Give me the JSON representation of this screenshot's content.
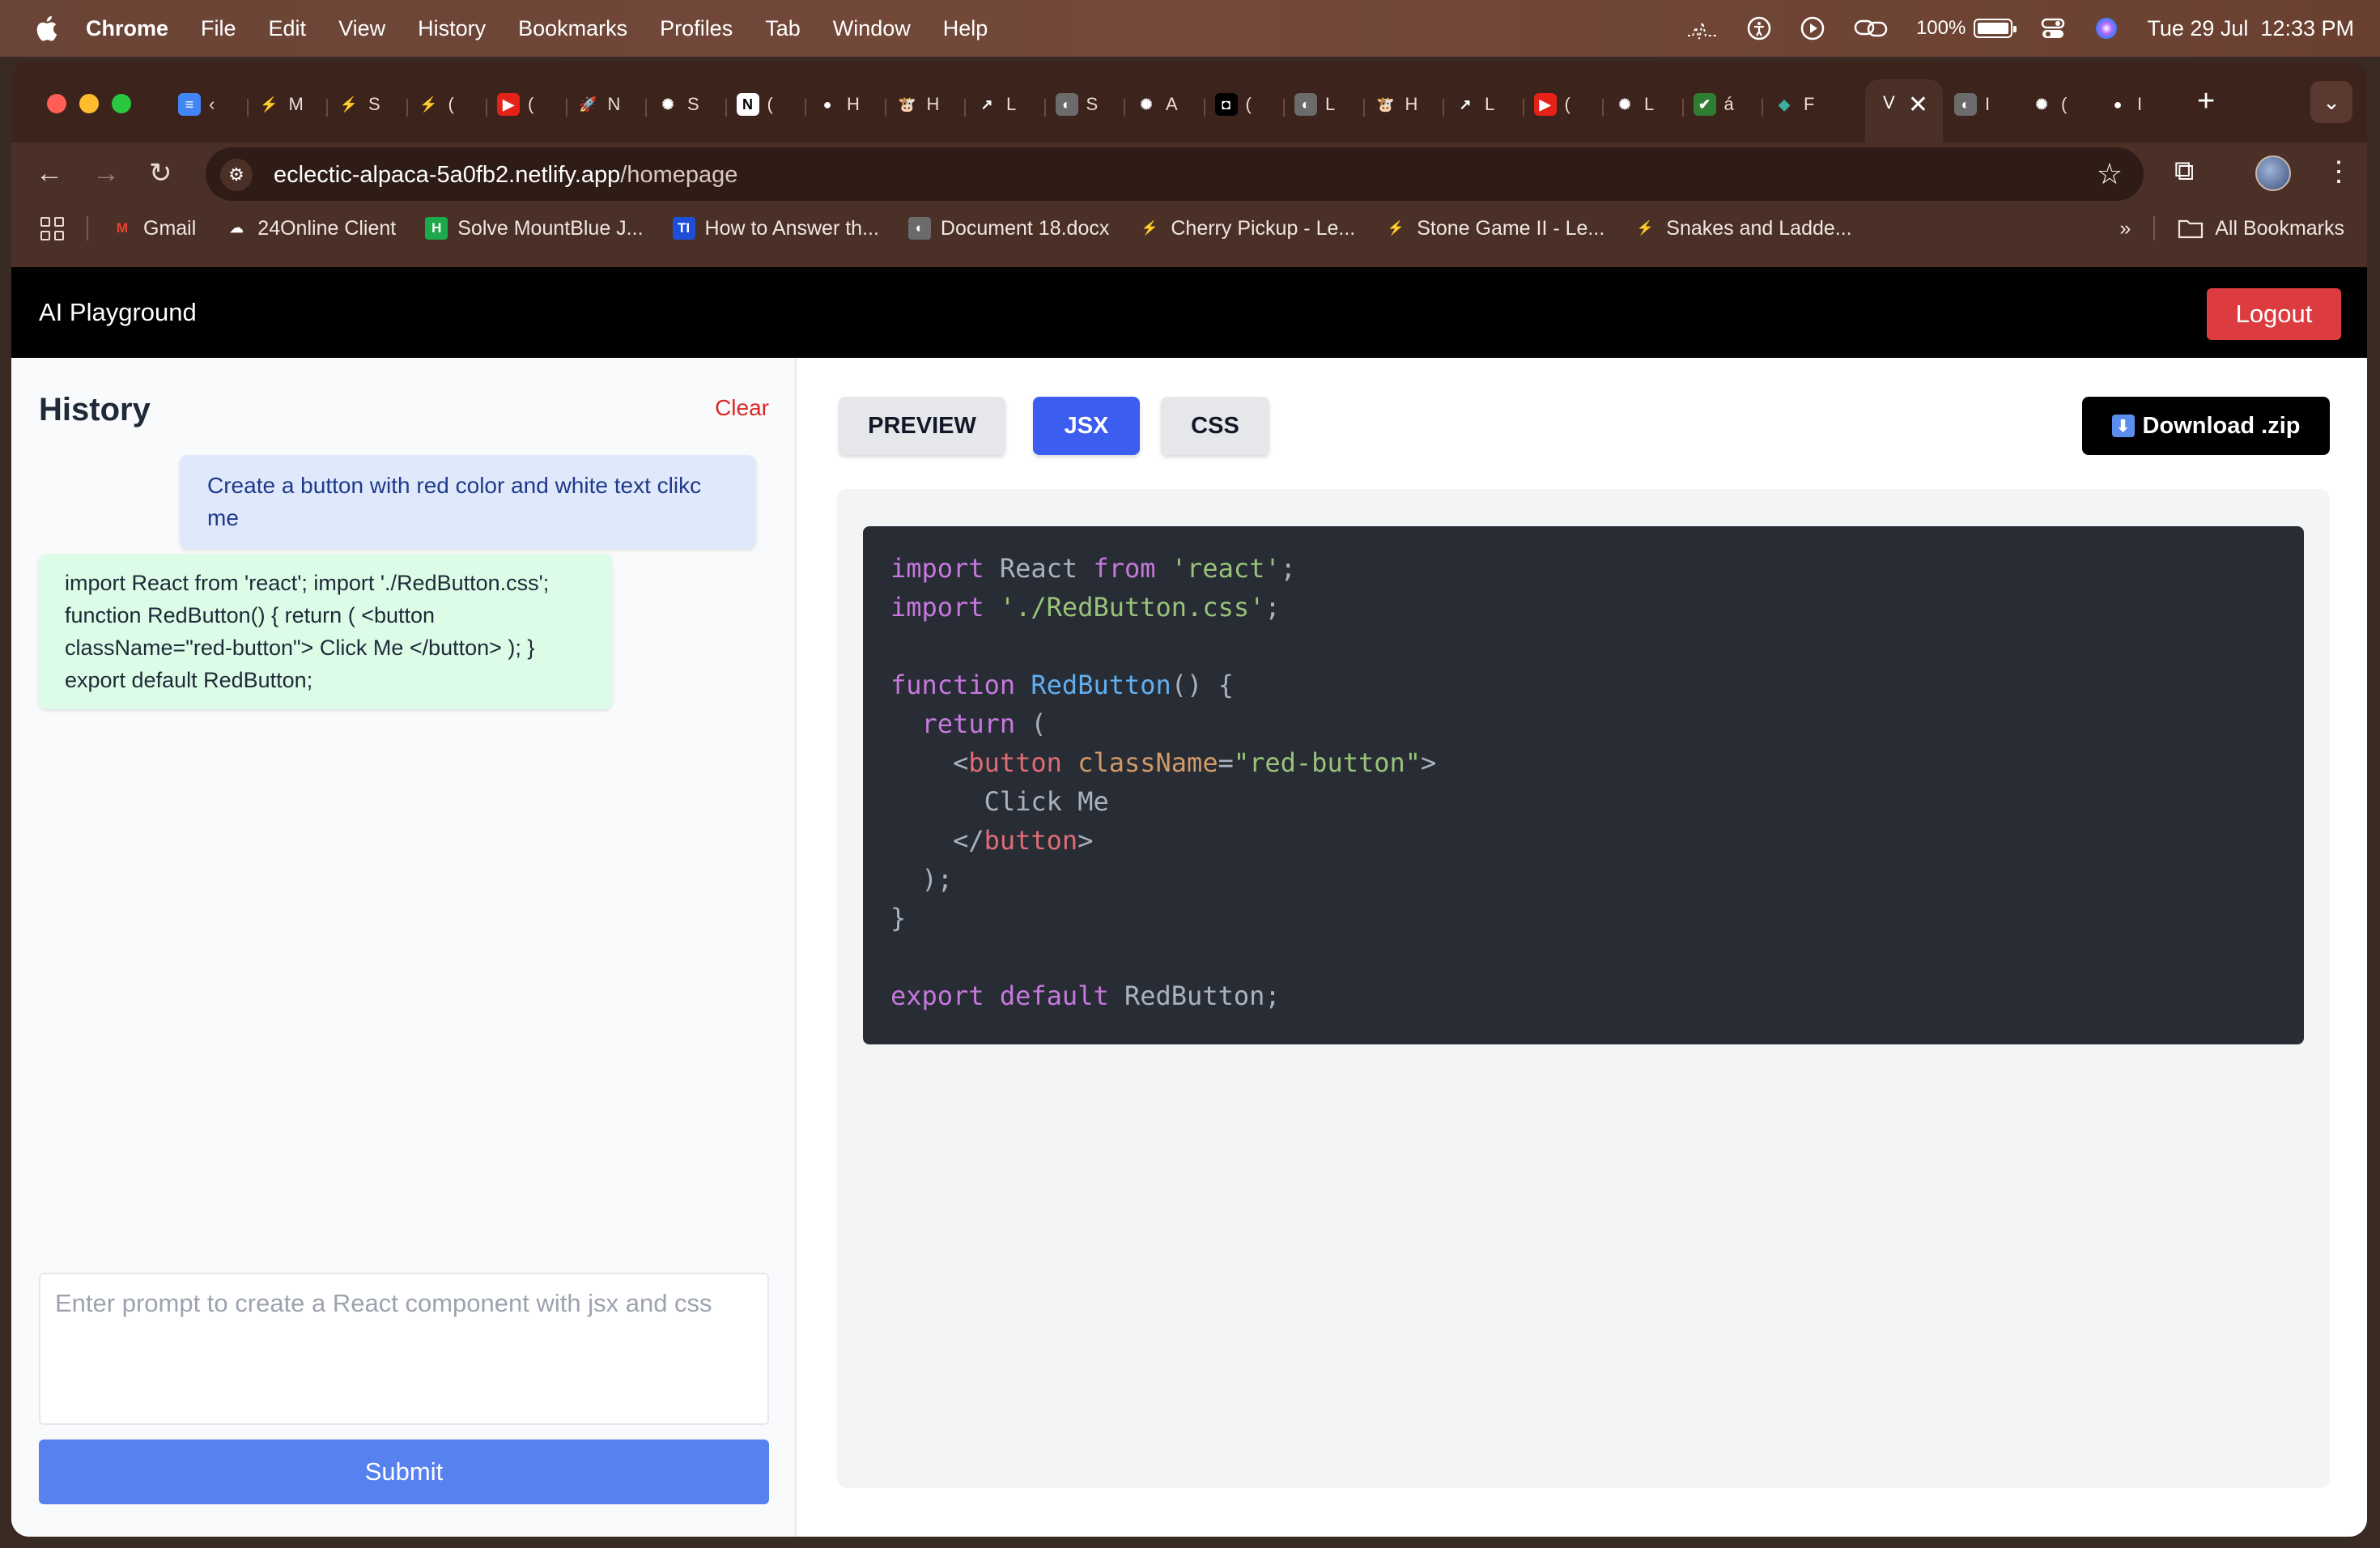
{
  "menubar": {
    "app": "Chrome",
    "items": [
      "File",
      "Edit",
      "View",
      "History",
      "Bookmarks",
      "Profiles",
      "Tab",
      "Window",
      "Help"
    ],
    "battery": "100%",
    "datetime": "Tue 29 Jul  12:33 PM"
  },
  "browser": {
    "tabs": [
      {
        "icon": "docs-icon",
        "text": "‹"
      },
      {
        "icon": "leetcode-icon",
        "text": "M"
      },
      {
        "icon": "leetcode-icon",
        "text": "S"
      },
      {
        "icon": "leetcode-icon",
        "text": "("
      },
      {
        "icon": "youtube-icon",
        "text": "("
      },
      {
        "icon": "rocket-icon",
        "text": "N"
      },
      {
        "icon": "chatgpt-icon",
        "text": "S"
      },
      {
        "icon": "notion-icon",
        "text": "("
      },
      {
        "icon": "github-icon",
        "text": "H"
      },
      {
        "icon": "cow-icon",
        "text": "H"
      },
      {
        "icon": "external-link-icon",
        "text": "L"
      },
      {
        "icon": "globe-icon",
        "text": "S"
      },
      {
        "icon": "chatgpt-icon",
        "text": "A"
      },
      {
        "icon": "app-icon",
        "text": "("
      },
      {
        "icon": "globe-icon",
        "text": "L"
      },
      {
        "icon": "cow-icon",
        "text": "H"
      },
      {
        "icon": "external-link-icon",
        "text": "L"
      },
      {
        "icon": "youtube-icon",
        "text": "("
      },
      {
        "icon": "chatgpt-icon",
        "text": "L"
      },
      {
        "icon": "check-icon",
        "text": "á"
      },
      {
        "icon": "diamond-icon",
        "text": "F"
      }
    ],
    "active_tab": "V",
    "trailing_tabs": [
      {
        "icon": "globe-icon",
        "text": "I"
      },
      {
        "icon": "chatgpt-icon",
        "text": "("
      },
      {
        "icon": "github-icon",
        "text": "I"
      }
    ],
    "url_host": "eclectic-alpaca-5a0fb2.netlify.app",
    "url_path": "/homepage",
    "bookmarks": [
      {
        "icon": "gmail-icon",
        "label": "Gmail"
      },
      {
        "icon": "cloud-icon",
        "label": "24Online Client"
      },
      {
        "icon": "hackerrank-icon",
        "label": "Solve MountBlue J..."
      },
      {
        "icon": "ti-icon",
        "label": "How to Answer th..."
      },
      {
        "icon": "globe-icon",
        "label": "Document 18.docx"
      },
      {
        "icon": "leetcode-icon",
        "label": "Cherry Pickup - Le..."
      },
      {
        "icon": "leetcode-icon",
        "label": "Stone Game II - Le..."
      },
      {
        "icon": "leetcode-icon",
        "label": "Snakes and Ladde..."
      }
    ],
    "all_bookmarks": "All Bookmarks"
  },
  "app": {
    "title": "AI Playground",
    "logout": "Logout",
    "history_title": "History",
    "clear": "Clear",
    "user_message": "Create a button with red color and white text clikc me",
    "bot_message": "import React from 'react'; import './RedButton.css'; function RedButton() { return ( <button className=\"red-button\"> Click Me </button> ); } export default RedButton;",
    "prompt_placeholder": "Enter prompt to create a React component with jsx and css",
    "submit": "Submit",
    "tabs": {
      "preview": "PREVIEW",
      "jsx": "JSX",
      "css": "CSS"
    },
    "active_tab": "JSX",
    "download": "Download .zip",
    "code_lines": [
      "import React from 'react';",
      "import './RedButton.css';",
      "",
      "function RedButton() {",
      "  return (",
      "    <button className=\"red-button\">",
      "      Click Me",
      "    </button>",
      "  );",
      "}",
      "",
      "export default RedButton;"
    ]
  },
  "colors": {
    "logout": "#dc3c3f",
    "submit": "#5681ee",
    "tab_active": "#3d5cf0",
    "code_bg": "#282c34",
    "user_bubble": "#e0e8fb",
    "bot_bubble": "#dcfce7"
  }
}
